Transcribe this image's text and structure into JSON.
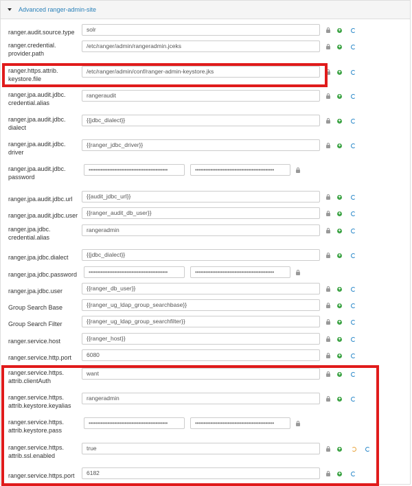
{
  "panel": {
    "title": "Advanced ranger-admin-site"
  },
  "rows": [
    {
      "label": "ranger.audit.source.type",
      "value": "solr"
    },
    {
      "label": "ranger.credential.\nprovider.path",
      "value": "/etc/ranger/admin/rangeradmin.jceks"
    },
    {
      "label": "ranger.https.attrib.\nkeystore.file",
      "value": "/etc/ranger/admin/conf/ranger-admin-keystore.jks"
    },
    {
      "label": "ranger.jpa.audit.jdbc.\ncredential.alias",
      "value": "rangeraudit"
    },
    {
      "label": "ranger.jpa.audit.jdbc.\ndialect",
      "value": "{{jdbc_dialect}}"
    },
    {
      "label": "ranger.jpa.audit.jdbc.\ndriver",
      "value": "{{ranger_jdbc_driver}}"
    },
    {
      "label": "ranger.jpa.audit.jdbc.\npassword",
      "value": "••••••••••••••••••••••••••••••••••••••••••••••",
      "confirm": "••••••••••••••••••••••••••••••••••••••••••••••"
    },
    {
      "label": "ranger.jpa.audit.jdbc.url",
      "value": "{{audit_jdbc_url}}"
    },
    {
      "label": "ranger.jpa.audit.jdbc.user",
      "value": "{{ranger_audit_db_user}}"
    },
    {
      "label": "ranger.jpa.jdbc.\ncredential.alias",
      "value": "rangeradmin"
    },
    {
      "label": "ranger.jpa.jdbc.dialect",
      "value": "{{jdbc_dialect}}"
    },
    {
      "label": "ranger.jpa.jdbc.password",
      "value": "••••••••••••••••••••••••••••••••••••••••••••••",
      "confirm": "••••••••••••••••••••••••••••••••••••••••••••••"
    },
    {
      "label": "ranger.jpa.jdbc.user",
      "value": "{{ranger_db_user}}"
    },
    {
      "label": "Group Search Base",
      "value": "{{ranger_ug_ldap_group_searchbase}}"
    },
    {
      "label": "Group Search Filter",
      "value": "{{ranger_ug_ldap_group_searchfilter}}"
    },
    {
      "label": "ranger.service.host",
      "value": "{{ranger_host}}"
    },
    {
      "label": "ranger.service.http.port",
      "value": "6080"
    },
    {
      "label": "ranger.service.https.\nattrib.clientAuth",
      "value": "want"
    },
    {
      "label": "ranger.service.https.\nattrib.keystore.keyalias",
      "value": "rangeradmin"
    },
    {
      "label": "ranger.service.https.\nattrib.keystore.pass",
      "value": "••••••••••••••••••••••••••••••••••••••••••••••",
      "confirm": "••••••••••••••••••••••••••••••••••••••••••••••"
    },
    {
      "label": "ranger.service.https.\nattrib.ssl.enabled",
      "value": "true"
    },
    {
      "label": "ranger.service.https.port",
      "value": "6182"
    }
  ],
  "colors": {
    "highlight": "#e01b1b",
    "add_icon": "#3ca344",
    "refresh_icon": "#2a88c9",
    "undo_icon": "#e8a33a",
    "title_link": "#2980b9"
  },
  "icons": {
    "lock": "lock-icon",
    "add": "plus-circle-icon",
    "refresh": "refresh-icon",
    "undo": "undo-icon"
  }
}
